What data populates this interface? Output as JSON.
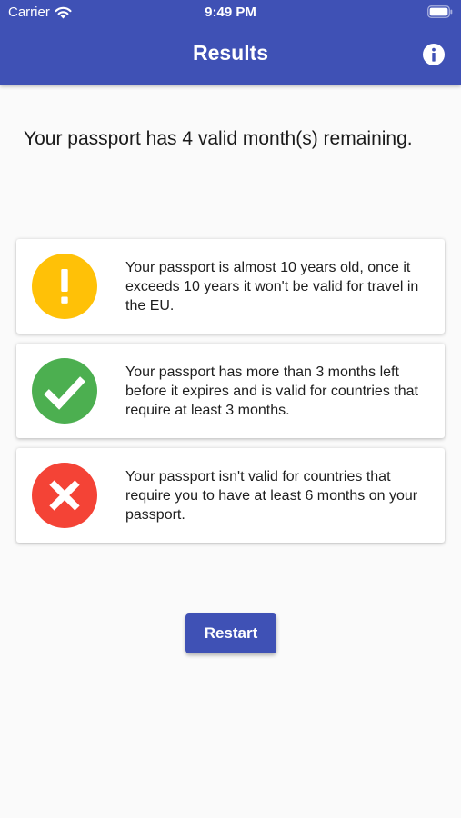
{
  "status_bar": {
    "carrier": "Carrier",
    "time": "9:49 PM"
  },
  "header": {
    "title": "Results",
    "info_icon": "info-icon"
  },
  "main": {
    "headline": "Your passport has 4 valid month(s) remaining.",
    "cards": [
      {
        "status": "warning",
        "icon": "exclamation-icon",
        "color": "#FFC107",
        "text": "Your passport is almost 10 years old, once it exceeds 10 years it won't be valid for travel in the EU."
      },
      {
        "status": "valid",
        "icon": "checkmark-icon",
        "color": "#4CAF50",
        "text": "Your passport has more than 3 months left before it expires and is valid for countries that require at least 3 months."
      },
      {
        "status": "invalid",
        "icon": "cross-icon",
        "color": "#F44336",
        "text": "Your passport isn't valid for countries that require you to have at least 6 months on your passport."
      }
    ],
    "restart_label": "Restart"
  },
  "colors": {
    "app_bar": "#3F51B5",
    "background": "#FAFAFA",
    "button": "#3F51B5"
  }
}
